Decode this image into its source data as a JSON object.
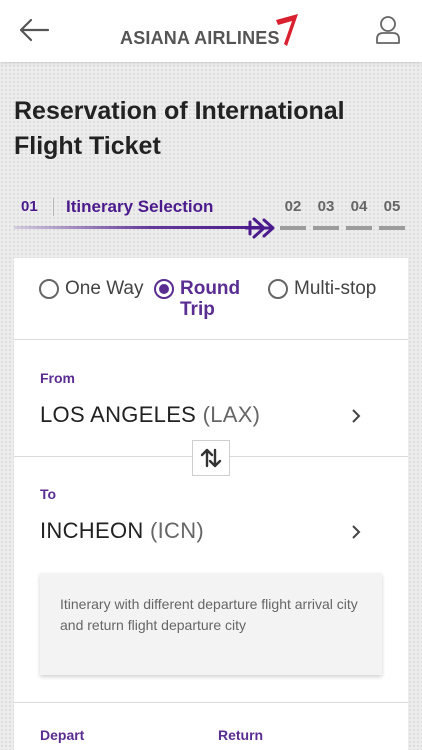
{
  "header": {
    "brand": "ASIANA AIRLINES",
    "back_icon": "arrow-left-icon",
    "user_icon": "user-icon",
    "logo_mark_color": "#d8202f"
  },
  "page": {
    "title": "Reservation of International Flight Ticket"
  },
  "steps": {
    "current": {
      "number": "01",
      "label": "Itinerary Selection"
    },
    "upcoming": [
      "02",
      "03",
      "04",
      "05"
    ],
    "accent_color": "#4b1a8c"
  },
  "trip_type": {
    "options": [
      {
        "label": "One Way",
        "selected": false
      },
      {
        "label": "Round Trip",
        "selected": true
      },
      {
        "label": "Multi-stop",
        "selected": false
      }
    ]
  },
  "from": {
    "label": "From",
    "city": "LOS ANGELES",
    "code": "(LAX)"
  },
  "to": {
    "label": "To",
    "city": "INCHEON",
    "code": "(ICN)"
  },
  "info_text": "Itinerary with different departure flight arrival city and return flight departure city",
  "dates": {
    "depart_label": "Depart",
    "return_label": "Return"
  }
}
